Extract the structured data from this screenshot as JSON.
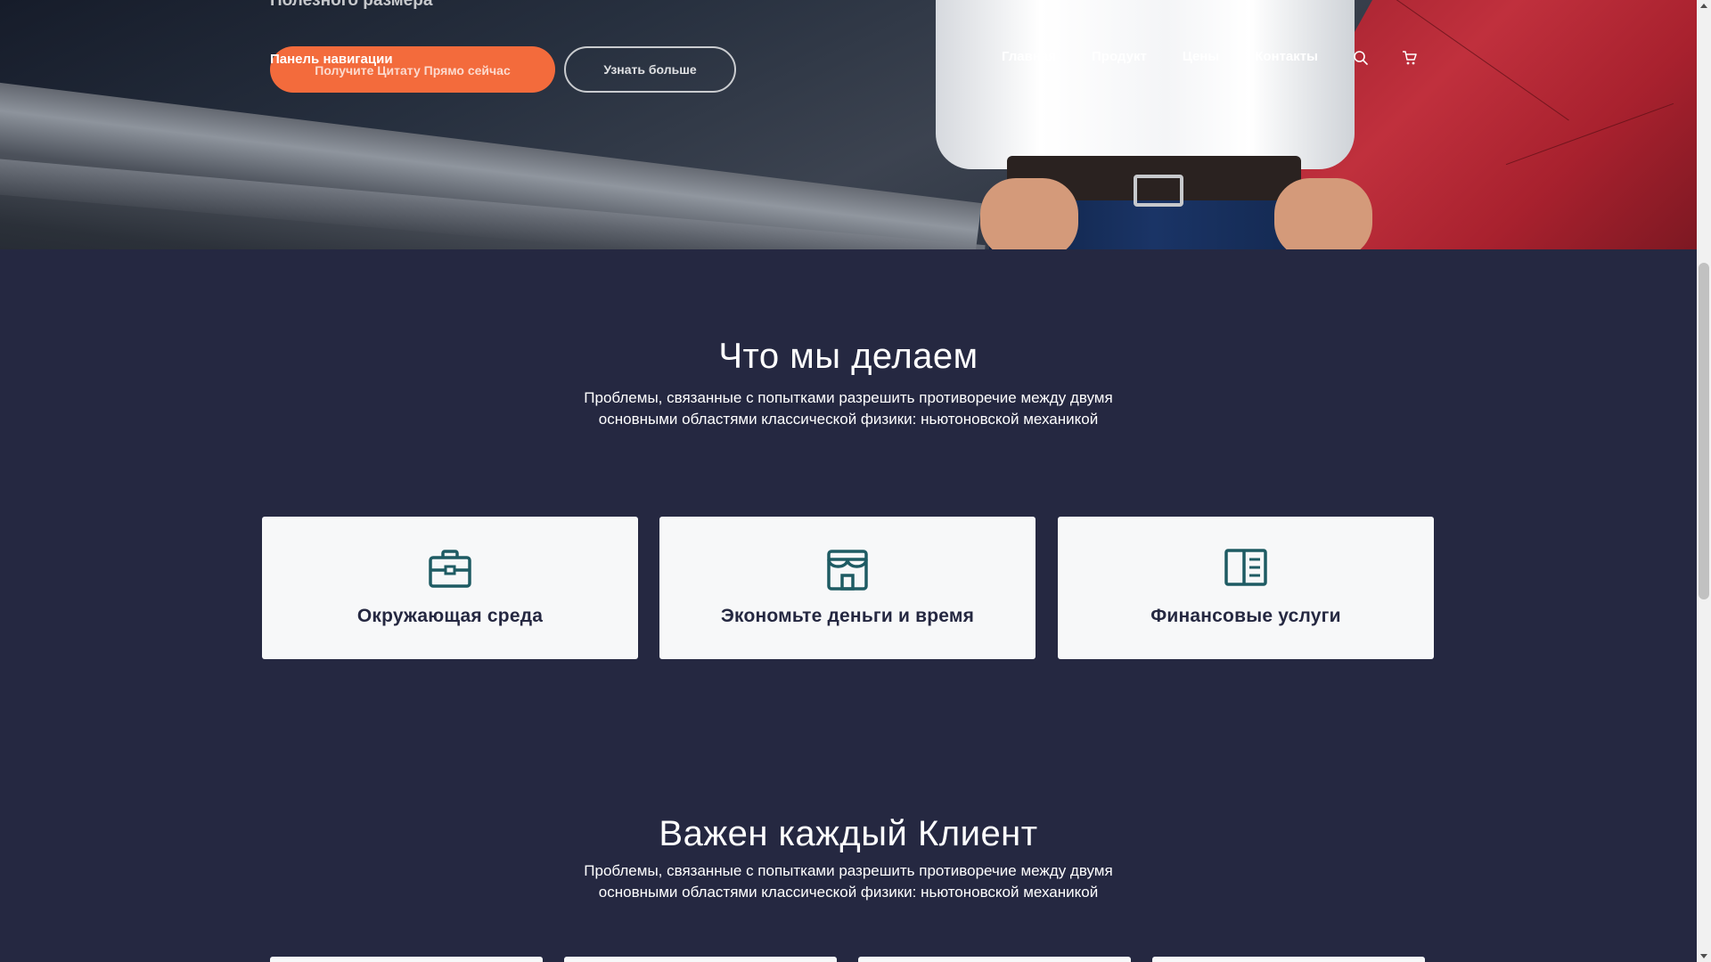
{
  "hero": {
    "subtitle": "Полезного размера",
    "nav_label": "Панель навигации",
    "cta_primary": "Получите Цитату Прямо сейчас",
    "cta_secondary": "Узнать больше"
  },
  "menu": {
    "items": [
      "Главная",
      "Продукт",
      "Цены",
      "Контакты"
    ],
    "search_icon": "search-icon",
    "cart_icon": "cart-icon"
  },
  "what_we_do": {
    "title": "Что мы делаем",
    "text_line1": "Проблемы, связанные с попытками разрешить противоречие между двумя",
    "text_line2": "основными областями классической физики: ньютоновской механикой",
    "cards": [
      {
        "title": "Окружающая среда",
        "icon": "briefcase-icon"
      },
      {
        "title": "Экономьте деньги и время",
        "icon": "store-icon"
      },
      {
        "title": "Финансовые услуги",
        "icon": "book-icon"
      }
    ]
  },
  "clients": {
    "title": "Важен каждый Клиент",
    "text_line1": "Проблемы, связанные с попытками разрешить противоречие между двумя",
    "text_line2": "основными областями классической физики: ньютоновской механикой"
  },
  "colors": {
    "background": "#252841",
    "accent": "#f36b3c",
    "icon_teal": "#1e5b63",
    "card": "#f7f8f9"
  }
}
